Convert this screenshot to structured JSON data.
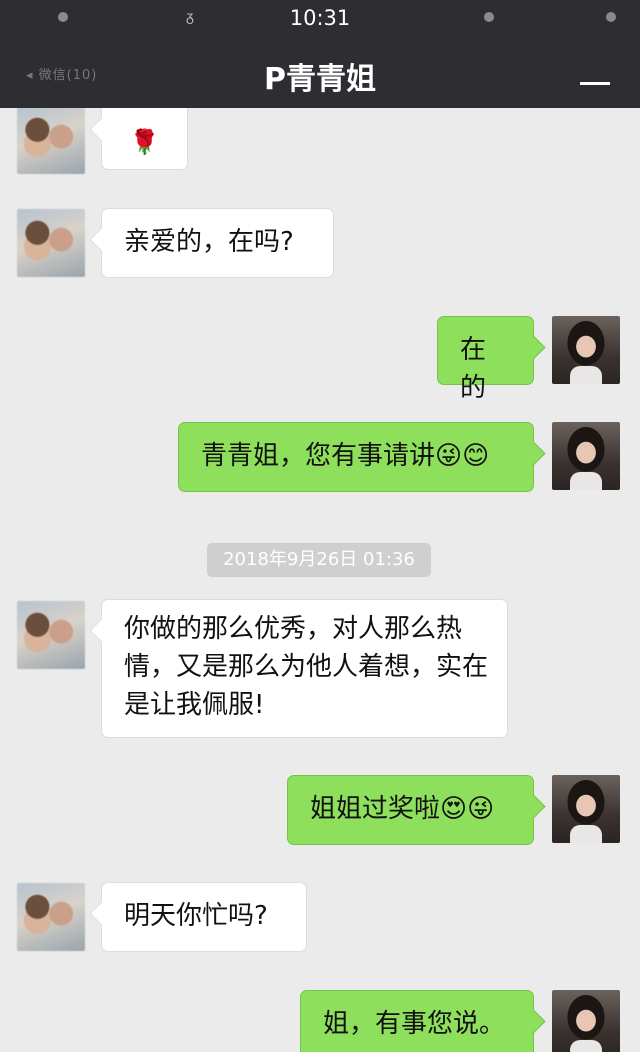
{
  "status_bar": {
    "time": "10:31"
  },
  "header": {
    "title": "P青青姐",
    "back_label": "◂ 微信(10)"
  },
  "messages": [
    {
      "side": "in",
      "text": "🌹"
    },
    {
      "side": "in",
      "text": "亲爱的，在吗?"
    },
    {
      "side": "out",
      "text": "在的"
    },
    {
      "side": "out",
      "text": "青青姐，您有事请讲😜😊"
    },
    {
      "side": "in",
      "text": "你做的那么优秀，对人那么热情，又是那么为他人着想，实在是让我佩服!"
    },
    {
      "side": "out",
      "text": "姐姐过奖啦😍😜"
    },
    {
      "side": "in",
      "text": "明天你忙吗?"
    },
    {
      "side": "out",
      "text": "姐，有事您说。"
    }
  ],
  "timestamp": "2018年9月26日 01:36",
  "colors": {
    "header_bg": "#2e2e32",
    "chat_bg": "#ebebeb",
    "outgoing_bubble": "#8ee05c",
    "incoming_bubble": "#ffffff"
  }
}
